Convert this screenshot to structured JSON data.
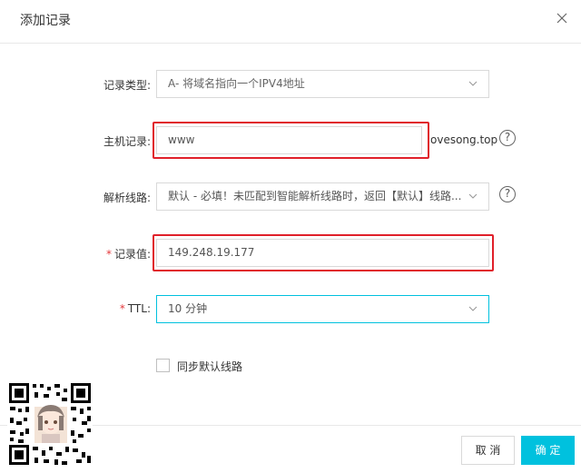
{
  "dialog": {
    "title": "添加记录"
  },
  "form": {
    "record_type": {
      "label": "记录类型:",
      "value": "A- 将域名指向一个IPV4地址"
    },
    "host": {
      "label": "主机记录:",
      "value": "www",
      "suffix": "ovesong.top"
    },
    "line": {
      "label": "解析线路:",
      "value": "默认 - 必填！未匹配到智能解析线路时，返回【默认】线路..."
    },
    "record_value": {
      "required_mark": "*",
      "label": "记录值:",
      "value": "149.248.19.177"
    },
    "ttl": {
      "required_mark": "*",
      "label": "TTL:",
      "value": "10 分钟"
    },
    "sync": {
      "label": "同步默认线路",
      "checked": false
    }
  },
  "footer": {
    "cancel_label": "取 消",
    "ok_label": "确 定"
  },
  "icons": {
    "help": "?",
    "close": "close-icon",
    "chevron": "chevron-down-icon"
  },
  "colors": {
    "accent": "#00c1de",
    "highlight": "#e0202a",
    "required": "#e4393c"
  }
}
